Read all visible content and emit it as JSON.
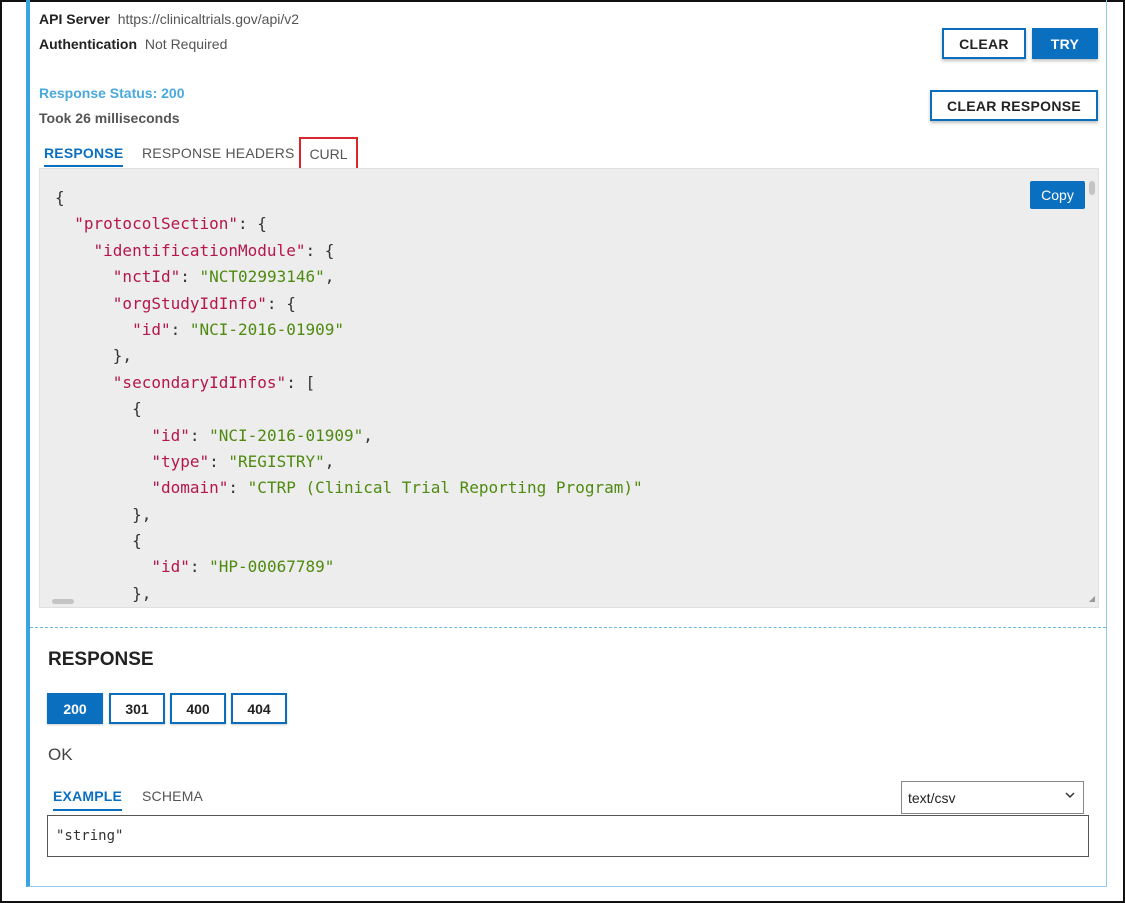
{
  "server": {
    "api_server_label": "API Server",
    "api_server_value": "https://clinicaltrials.gov/api/v2",
    "auth_label": "Authentication",
    "auth_value": "Not Required"
  },
  "actions": {
    "clear_label": "CLEAR",
    "try_label": "TRY",
    "clear_response_label": "CLEAR RESPONSE"
  },
  "response_meta": {
    "status": "Response Status: 200",
    "took": "Took 26 milliseconds"
  },
  "response_tabs": [
    {
      "label": "RESPONSE",
      "active": true
    },
    {
      "label": "RESPONSE HEADERS",
      "active": false
    },
    {
      "label": "CURL",
      "active": false,
      "highlighted": true
    }
  ],
  "code_view": {
    "copy_label": "Copy",
    "lines": [
      "{",
      "  \"protocolSection\": {",
      "    \"identificationModule\": {",
      "      \"nctId\": \"NCT02993146\",",
      "      \"orgStudyIdInfo\": {",
      "        \"id\": \"NCI-2016-01909\"",
      "      },",
      "      \"secondaryIdInfos\": [",
      "        {",
      "          \"id\": \"NCI-2016-01909\",",
      "          \"type\": \"REGISTRY\",",
      "          \"domain\": \"CTRP (Clinical Trial Reporting Program)\"",
      "        },",
      "        {",
      "          \"id\": \"HP-00067789\"",
      "        },"
    ]
  },
  "response_section": {
    "title": "RESPONSE",
    "codes": [
      {
        "label": "200",
        "active": true
      },
      {
        "label": "301",
        "active": false
      },
      {
        "label": "400",
        "active": false
      },
      {
        "label": "404",
        "active": false
      }
    ],
    "description": "OK",
    "tabs": [
      {
        "label": "EXAMPLE",
        "active": true
      },
      {
        "label": "SCHEMA",
        "active": false
      }
    ],
    "content_type": "text/csv",
    "example_value": "\"string\""
  },
  "colors": {
    "accent": "#0b6fc0",
    "status": "#4aa8dc",
    "highlight_border": "#d9262b",
    "json_key": "#b4164d",
    "json_string": "#4f8a10"
  }
}
